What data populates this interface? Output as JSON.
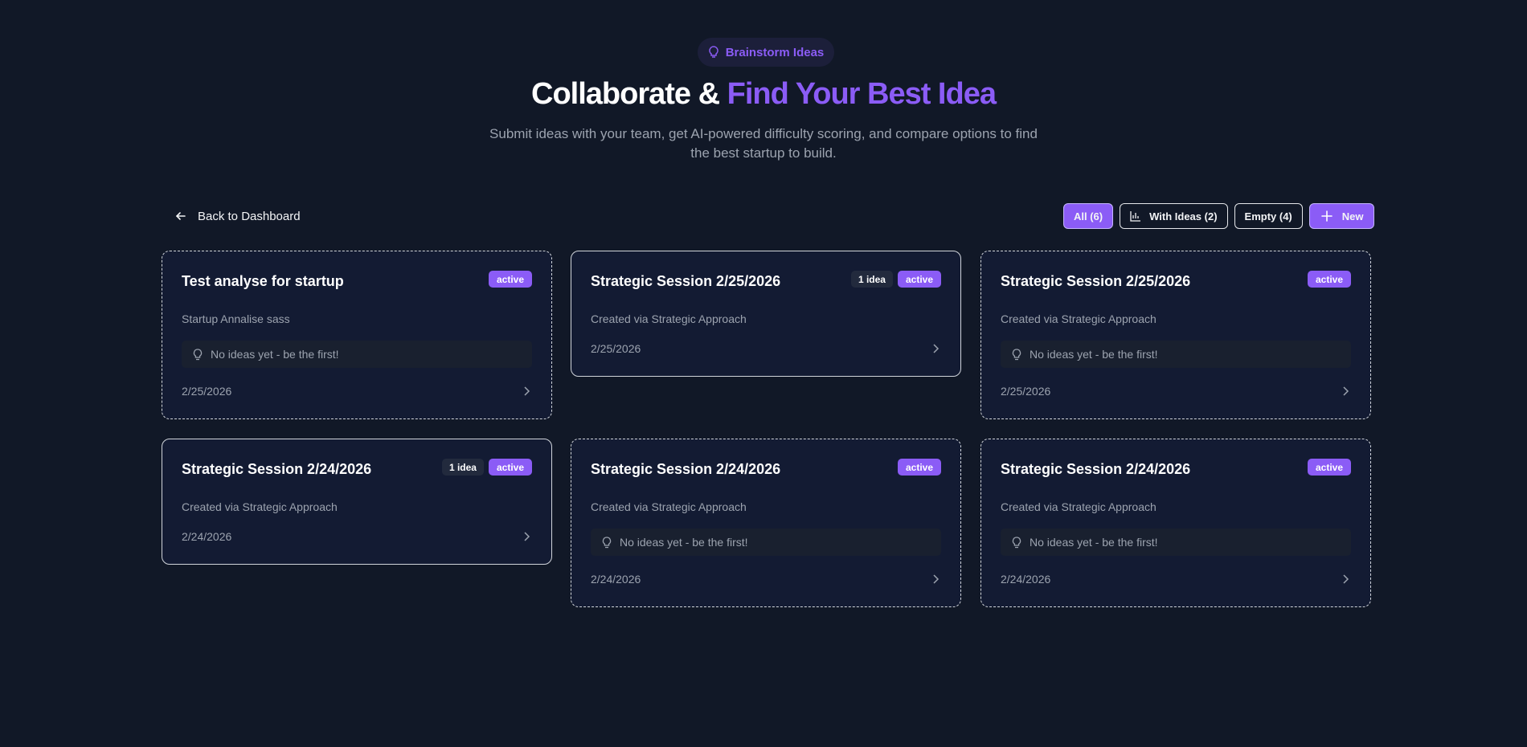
{
  "header": {
    "badge_label": "Brainstorm Ideas",
    "badge_icon": "lightbulb-icon",
    "title_main": "Collaborate & ",
    "title_accent": "Find Your Best Idea",
    "subtitle": "Submit ideas with your team, get AI-powered difficulty scoring, and compare options to find the best startup to build."
  },
  "toolbar": {
    "back_label": "Back to Dashboard",
    "filters": [
      {
        "label": "All (6)",
        "active": true
      },
      {
        "label": "With Ideas (2)",
        "icon": "bar-chart-icon"
      },
      {
        "label": "Empty (4)"
      }
    ],
    "new_label": "New"
  },
  "sessions": [
    {
      "title": "Test analyse for startup",
      "status": "active",
      "idea_count": "",
      "description": "Startup Annalise sass",
      "empty_text": "No ideas yet - be the first!",
      "date": "2/25/2026"
    },
    {
      "title": "Strategic Session 2/25/2026",
      "status": "active",
      "idea_count": "1 idea",
      "description": "Created via Strategic Approach",
      "empty_text": "",
      "date": "2/25/2026"
    },
    {
      "title": "Strategic Session 2/25/2026",
      "status": "active",
      "idea_count": "",
      "description": "Created via Strategic Approach",
      "empty_text": "No ideas yet - be the first!",
      "date": "2/25/2026"
    },
    {
      "title": "Strategic Session 2/24/2026",
      "status": "active",
      "idea_count": "1 idea",
      "description": "Created via Strategic Approach",
      "empty_text": "",
      "date": "2/24/2026"
    },
    {
      "title": "Strategic Session 2/24/2026",
      "status": "active",
      "idea_count": "",
      "description": "Created via Strategic Approach",
      "empty_text": "No ideas yet - be the first!",
      "date": "2/24/2026"
    },
    {
      "title": "Strategic Session 2/24/2026",
      "status": "active",
      "idea_count": "",
      "description": "Created via Strategic Approach",
      "empty_text": "No ideas yet - be the first!",
      "date": "2/24/2026"
    }
  ],
  "colors": {
    "background": "#111827",
    "card": "#131b33",
    "accent": "#8b5cf6",
    "muted_text": "#9ca3af"
  }
}
